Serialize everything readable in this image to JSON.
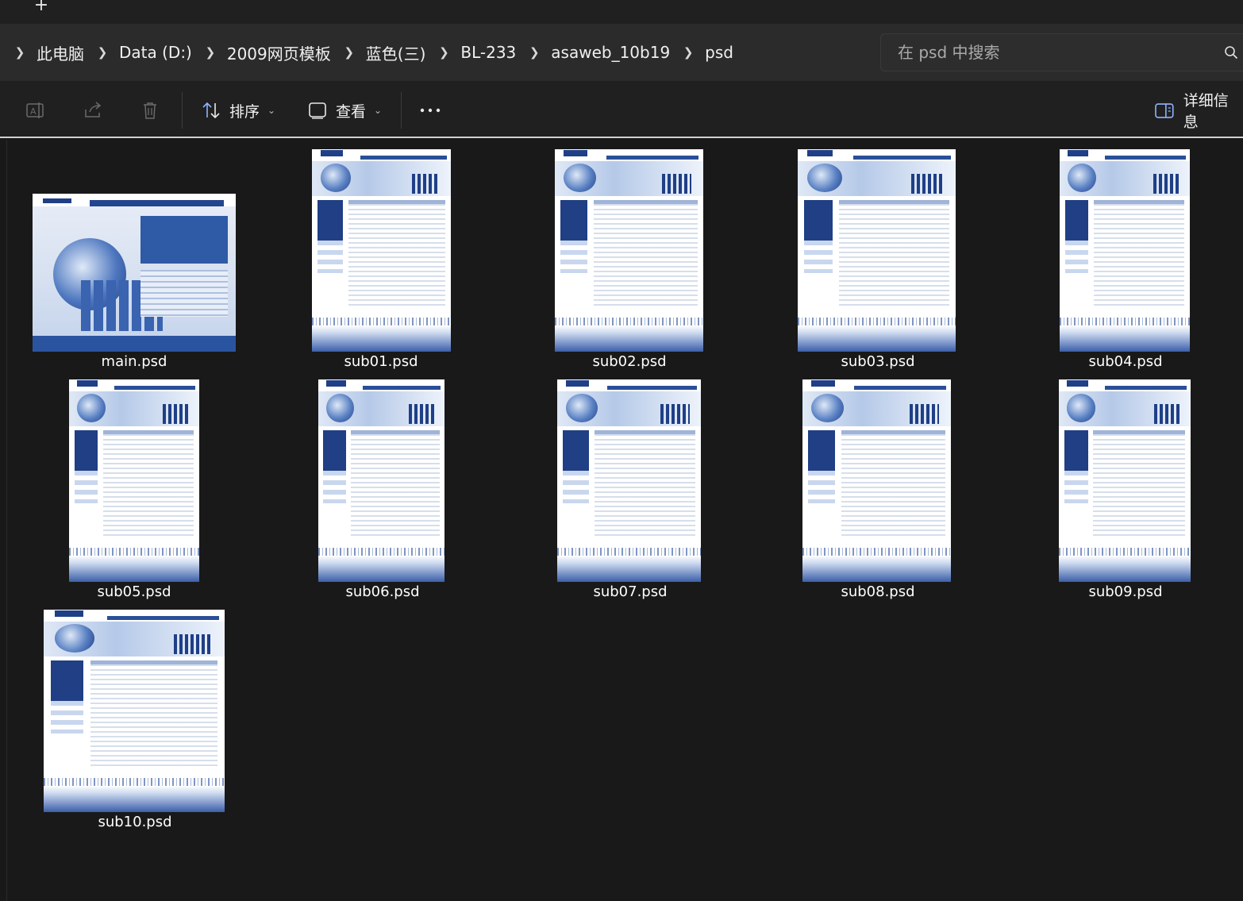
{
  "tabs": {
    "new_tab": "+"
  },
  "breadcrumb": [
    "此电脑",
    "Data (D:)",
    "2009网页模板",
    "蓝色(三)",
    "BL-233",
    "asaweb_10b19",
    "psd"
  ],
  "search": {
    "placeholder": "在 psd 中搜索"
  },
  "toolbar": {
    "sort_label": "排序",
    "view_label": "查看",
    "details_label": "详细信息"
  },
  "files": [
    {
      "name": "main.psd"
    },
    {
      "name": "sub01.psd"
    },
    {
      "name": "sub02.psd"
    },
    {
      "name": "sub03.psd"
    },
    {
      "name": "sub04.psd"
    },
    {
      "name": "sub05.psd"
    },
    {
      "name": "sub06.psd"
    },
    {
      "name": "sub07.psd"
    },
    {
      "name": "sub08.psd"
    },
    {
      "name": "sub09.psd"
    },
    {
      "name": "sub10.psd"
    }
  ],
  "colors": {
    "background": "#191919",
    "toolbar": "#202020",
    "addressbar": "#2b2b2b",
    "thumbnail_blue": "#23458f"
  },
  "icons": [
    "new-tab-icon",
    "chevron-right-icon",
    "search-icon",
    "rename-icon",
    "share-icon",
    "delete-icon",
    "sort-icon",
    "view-icon",
    "more-icon",
    "details-pane-icon"
  ]
}
